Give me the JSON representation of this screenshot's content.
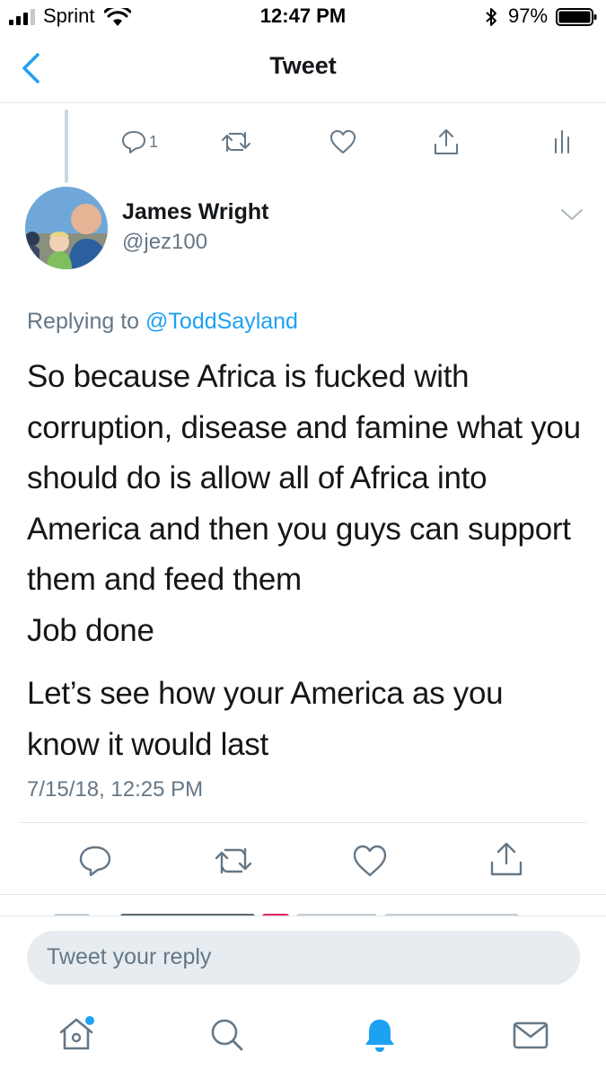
{
  "status_bar": {
    "carrier": "Sprint",
    "time": "12:47 PM",
    "battery_percent": "97%",
    "battery_level": 0.97,
    "signal_bars": 3
  },
  "nav": {
    "title": "Tweet",
    "back_icon": "chevron-left-icon"
  },
  "parent_tweet": {
    "reply_count": "1",
    "actions": [
      "reply-icon",
      "retweet-icon",
      "like-icon",
      "share-icon",
      "analytics-icon"
    ]
  },
  "tweet": {
    "author_name": "James Wright",
    "author_handle": "@jez100",
    "replying_prefix": "Replying to",
    "replying_mention": "@ToddSayland",
    "body_paragraph_1": "So because Africa is fucked with corruption, disease and famine what you should do is allow all of Africa into America and then you guys can support them and feed them\nJob done",
    "body_paragraph_2": "Let’s see how your America as you know it would last",
    "timestamp": "7/15/18, 12:25 PM",
    "actions": [
      "reply-icon",
      "retweet-icon",
      "like-icon",
      "share-icon"
    ]
  },
  "compose": {
    "placeholder": "Tweet your reply"
  },
  "tab_bar": {
    "items": [
      "home-icon",
      "search-icon",
      "notifications-icon",
      "messages-icon"
    ],
    "active": "notifications-icon",
    "home_has_dot": true
  },
  "colors": {
    "accent": "#1da1f2",
    "secondary_text": "#657786",
    "divider": "#e1e8ed",
    "input_bg": "#e6ecf0"
  }
}
